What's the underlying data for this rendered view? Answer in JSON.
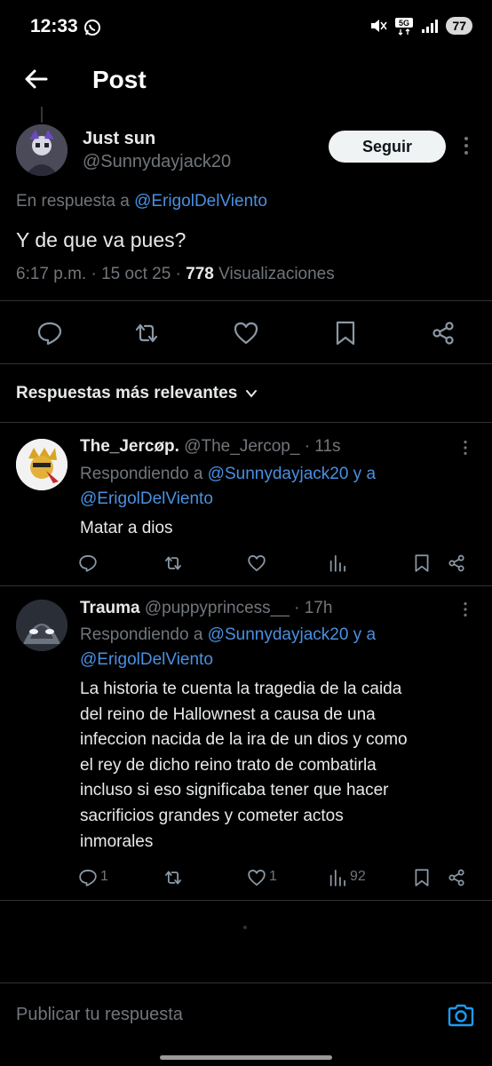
{
  "status_bar": {
    "time": "12:33",
    "battery": "77",
    "network": "5G"
  },
  "header": {
    "title": "Post"
  },
  "main_post": {
    "author_name": "Just sun",
    "author_handle": "@Sunnydayjack20",
    "follow_label": "Seguir",
    "reply_prefix": "En respuesta a",
    "reply_handle": "@ErigolDelViento",
    "text": "Y de que va pues?",
    "time": "6:17 p.m. · 15 oct 25 · ",
    "views_count": "778",
    "views_label": " Visualizaciones"
  },
  "sort_label": "Respuestas más relevantes",
  "replies": [
    {
      "name": "The_Jercøp.",
      "handle": "@The_Jercop_",
      "time": "· 11s",
      "replying_prefix": "Respondiendo a",
      "replying_handle_1": "@Sunnydayjack20 y a",
      "replying_handle_2": "@ErigolDelViento",
      "text": "Matar a dios"
    },
    {
      "name": "Trauma",
      "handle": "@puppyprincess__",
      "time": "· 17h",
      "replying_prefix": "Respondiendo a",
      "replying_handle_1": "@Sunnydayjack20 y a",
      "replying_handle_2": "@ErigolDelViento",
      "text_lines": [
        "La historia te cuenta la tragedia de la caida",
        "del reino de Hallownest a causa de una",
        "infeccion nacida de la ira de un dios y como",
        "el rey de dicho reino trato de combatirla",
        "incluso si eso significaba tener que hacer",
        "sacrificios grandes y cometer actos",
        "inmorales"
      ],
      "reply_count": "1",
      "like_count": "1",
      "views_count": "92"
    }
  ],
  "compose": {
    "placeholder": "Publicar tu respuesta"
  },
  "colors": {
    "link": "#4a90e2",
    "background": "#000000",
    "muted": "#71767b"
  }
}
